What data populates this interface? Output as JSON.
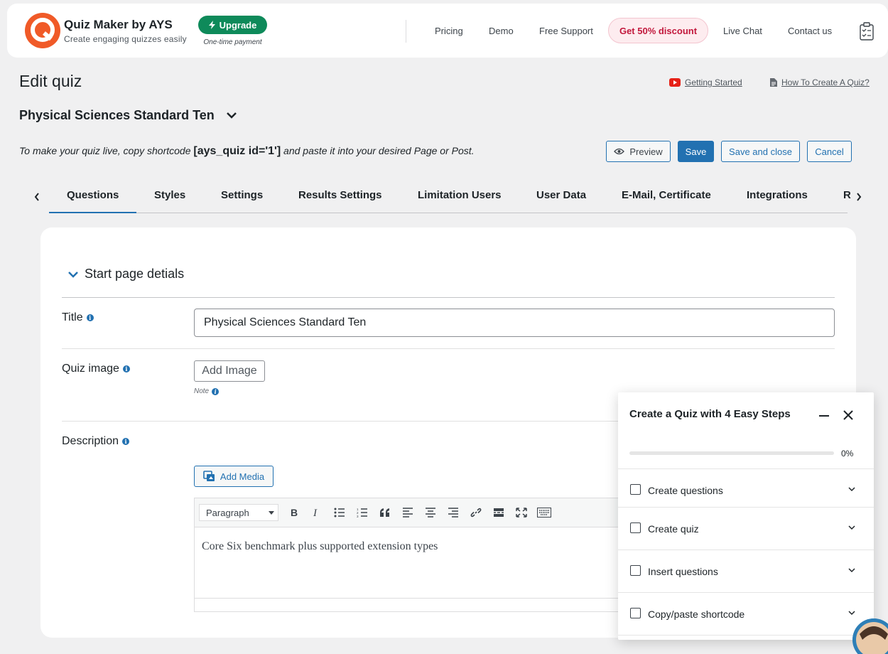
{
  "brand": {
    "title": "Quiz Maker by AYS",
    "subtitle": "Create engaging quizzes easily",
    "upgrade_label": "Upgrade",
    "upgrade_sub": "One-time payment"
  },
  "topnav": {
    "pricing": "Pricing",
    "demo": "Demo",
    "support": "Free Support",
    "discount": "Get 50% discount",
    "live_chat": "Live Chat",
    "contact": "Contact us"
  },
  "header": {
    "page_title": "Edit quiz",
    "getting_started": "Getting Started",
    "how_to": "How To Create A Quiz?",
    "quiz_name": "Physical Sciences Standard Ten",
    "shortcode_prefix": "To make your quiz live, copy shortcode",
    "shortcode": "[ays_quiz id='1']",
    "shortcode_suffix": "and paste it into your desired Page or Post."
  },
  "actions": {
    "preview": "Preview",
    "save": "Save",
    "save_close": "Save and close",
    "cancel": "Cancel"
  },
  "tabs": [
    "Questions",
    "Styles",
    "Settings",
    "Results Settings",
    "Limitation Users",
    "User Data",
    "E-Mail, Certificate",
    "Integrations",
    "R"
  ],
  "active_tab": "Questions",
  "form": {
    "section_title": "Start page detials",
    "title_label": "Title",
    "title_value": "Physical Sciences Standard Ten",
    "image_label": "Quiz image",
    "add_image": "Add Image",
    "note": "Note",
    "description_label": "Description",
    "add_media": "Add Media",
    "format_value": "Paragraph",
    "description_text": "Core Six benchmark plus supported extension types"
  },
  "steps_panel": {
    "title": "Create a Quiz with 4 Easy Steps",
    "progress": 0,
    "progress_label": "0%",
    "steps": [
      "Create questions",
      "Create quiz",
      "Insert questions",
      "Copy/paste shortcode"
    ]
  },
  "colors": {
    "accent": "#2271b1",
    "upgrade": "#0e8a5a",
    "discount_text": "#c2183c",
    "logo": "#f05a28"
  }
}
